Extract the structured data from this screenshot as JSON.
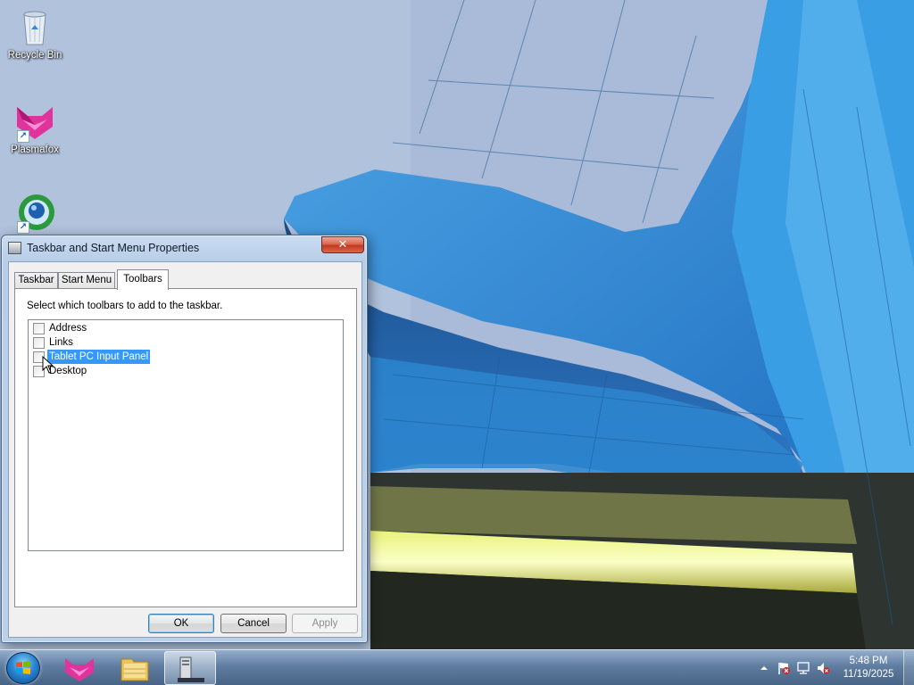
{
  "desktop": {
    "icons": [
      {
        "label": "Recycle Bin",
        "icon": "recycle-bin-icon"
      },
      {
        "label": "Plasmafox",
        "icon": "plasmafox-icon"
      },
      {
        "label": "",
        "icon": "network-globe-icon"
      }
    ]
  },
  "dialog": {
    "title": "Taskbar and Start Menu Properties",
    "close_label": "✕",
    "tabs": [
      {
        "label": "Taskbar",
        "active": false
      },
      {
        "label": "Start Menu",
        "active": false
      },
      {
        "label": "Toolbars",
        "active": true
      }
    ],
    "instructions": "Select which toolbars to add to the taskbar.",
    "toolbars": [
      {
        "label": "Address",
        "checked": false,
        "selected": false
      },
      {
        "label": "Links",
        "checked": false,
        "selected": false
      },
      {
        "label": "Tablet PC Input Panel",
        "checked": false,
        "selected": true
      },
      {
        "label": "Desktop",
        "checked": false,
        "selected": false
      }
    ],
    "buttons": {
      "ok": "OK",
      "cancel": "Cancel",
      "apply": "Apply"
    }
  },
  "taskbar": {
    "start": "start-orb-icon",
    "pinned": [
      {
        "icon": "plasmafox-icon",
        "active": false
      },
      {
        "icon": "explorer-folder-icon",
        "active": false
      },
      {
        "icon": "taskbar-properties-icon",
        "active": true
      }
    ],
    "tray_icons": [
      "show-hidden-icons-arrow",
      "action-center-flag-icon",
      "network-icon",
      "volume-muted-icon"
    ],
    "clock": {
      "time": "5:48 PM",
      "date": "11/19/2025"
    }
  },
  "colors": {
    "selection": "#3399ff",
    "close_button": "#c2391d",
    "taskbar": "#5f7da0"
  }
}
